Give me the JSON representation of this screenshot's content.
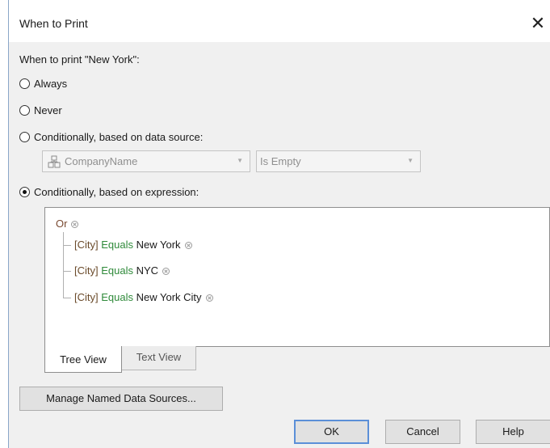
{
  "dialog": {
    "title": "When to Print",
    "close_glyph": "✕"
  },
  "prompt": "When to print \"New York\":",
  "options": [
    {
      "label": "Always",
      "selected": false
    },
    {
      "label": "Never",
      "selected": false
    },
    {
      "label": "Conditionally, based on data source:",
      "selected": false
    },
    {
      "label": "Conditionally, based on expression:",
      "selected": true
    }
  ],
  "datasource": {
    "field_value": "CompanyName",
    "field_icon": "database-table-icon",
    "operator_value": "Is Empty"
  },
  "expression": {
    "group_operator": "Or",
    "conditions": [
      {
        "field": "[City]",
        "operator": "Equals",
        "value": "New York"
      },
      {
        "field": "[City]",
        "operator": "Equals",
        "value": "NYC"
      },
      {
        "field": "[City]",
        "operator": "Equals",
        "value": "New York City"
      }
    ]
  },
  "tabs": [
    {
      "label": "Tree View",
      "active": true
    },
    {
      "label": "Text View",
      "active": false
    }
  ],
  "buttons": {
    "manage": "Manage Named Data Sources...",
    "ok": "OK",
    "cancel": "Cancel",
    "help": "Help"
  },
  "colors": {
    "field": "#6a4a2a",
    "operator": "#2f8a3a",
    "default_button_border": "#5b8fd8"
  }
}
